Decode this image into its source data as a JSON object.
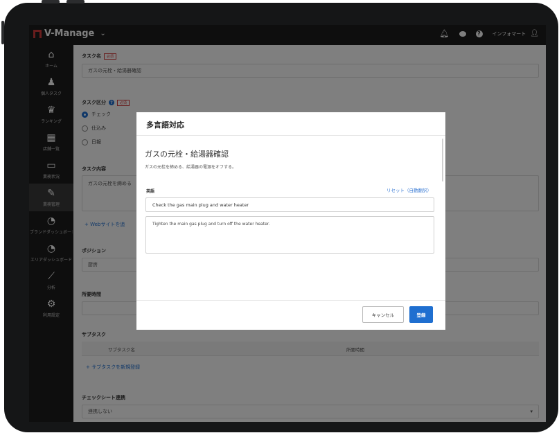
{
  "app": {
    "name": "V-Manage",
    "user_name": "インフォマート",
    "icons": [
      "bell-icon",
      "chat-icon",
      "help-icon",
      "user-icon"
    ]
  },
  "sidebar": {
    "items": [
      {
        "label": "ホーム",
        "icon": "⌂"
      },
      {
        "label": "個人タスク",
        "icon": "👤"
      },
      {
        "label": "ランキング",
        "icon": "♛"
      },
      {
        "label": "店舗一覧",
        "icon": "▦"
      },
      {
        "label": "業務状況",
        "icon": "☰"
      },
      {
        "label": "業務管理",
        "icon": "⚙"
      },
      {
        "label": "ブランドダッシュボード",
        "icon": "◔"
      },
      {
        "label": "エリアダッシュボード",
        "icon": "◔"
      },
      {
        "label": "分析",
        "icon": "📈"
      },
      {
        "label": "利用設定",
        "icon": "⚙"
      }
    ]
  },
  "form": {
    "task_name_label": "タスク名",
    "required_badge": "必須",
    "task_name_value": "ガスの元栓・給湯器確認",
    "task_type_label": "タスク区分",
    "task_type_options": [
      "チェック",
      "仕込み",
      "日報"
    ],
    "task_content_label": "タスク内容",
    "task_content_value": "ガスの元栓を締める",
    "add_website_link": "+ Webサイトを追",
    "position_label": "ポジション",
    "position_value": "厨房",
    "duration_label": "所要時間",
    "subtask_label": "サブタスク",
    "subtask_col_name": "サブタスク名",
    "subtask_col_duration": "所要時間",
    "subtask_add_link": "+ サブタスクを新規登録",
    "checksheet_label": "チェックシート連携",
    "checksheet_value": "連携しない"
  },
  "modal": {
    "title": "多言語対応",
    "subtitle": "ガスの元栓・給湯器確認",
    "description": "ガスの元栓を締める、給湯器の電源をオフする。",
    "language_label": "英語",
    "reset_link": "リセット（自動翻訳）",
    "name_value": "Check the gas main plug and water heater",
    "content_value": "Tighten the main gas plug and turn off the water heater.",
    "cancel_label": "キャンセル",
    "save_label": "登録"
  },
  "colors": {
    "primary": "#1f6fd0",
    "required": "#d23a3a",
    "sidebar_bg": "#1c1c1c"
  }
}
